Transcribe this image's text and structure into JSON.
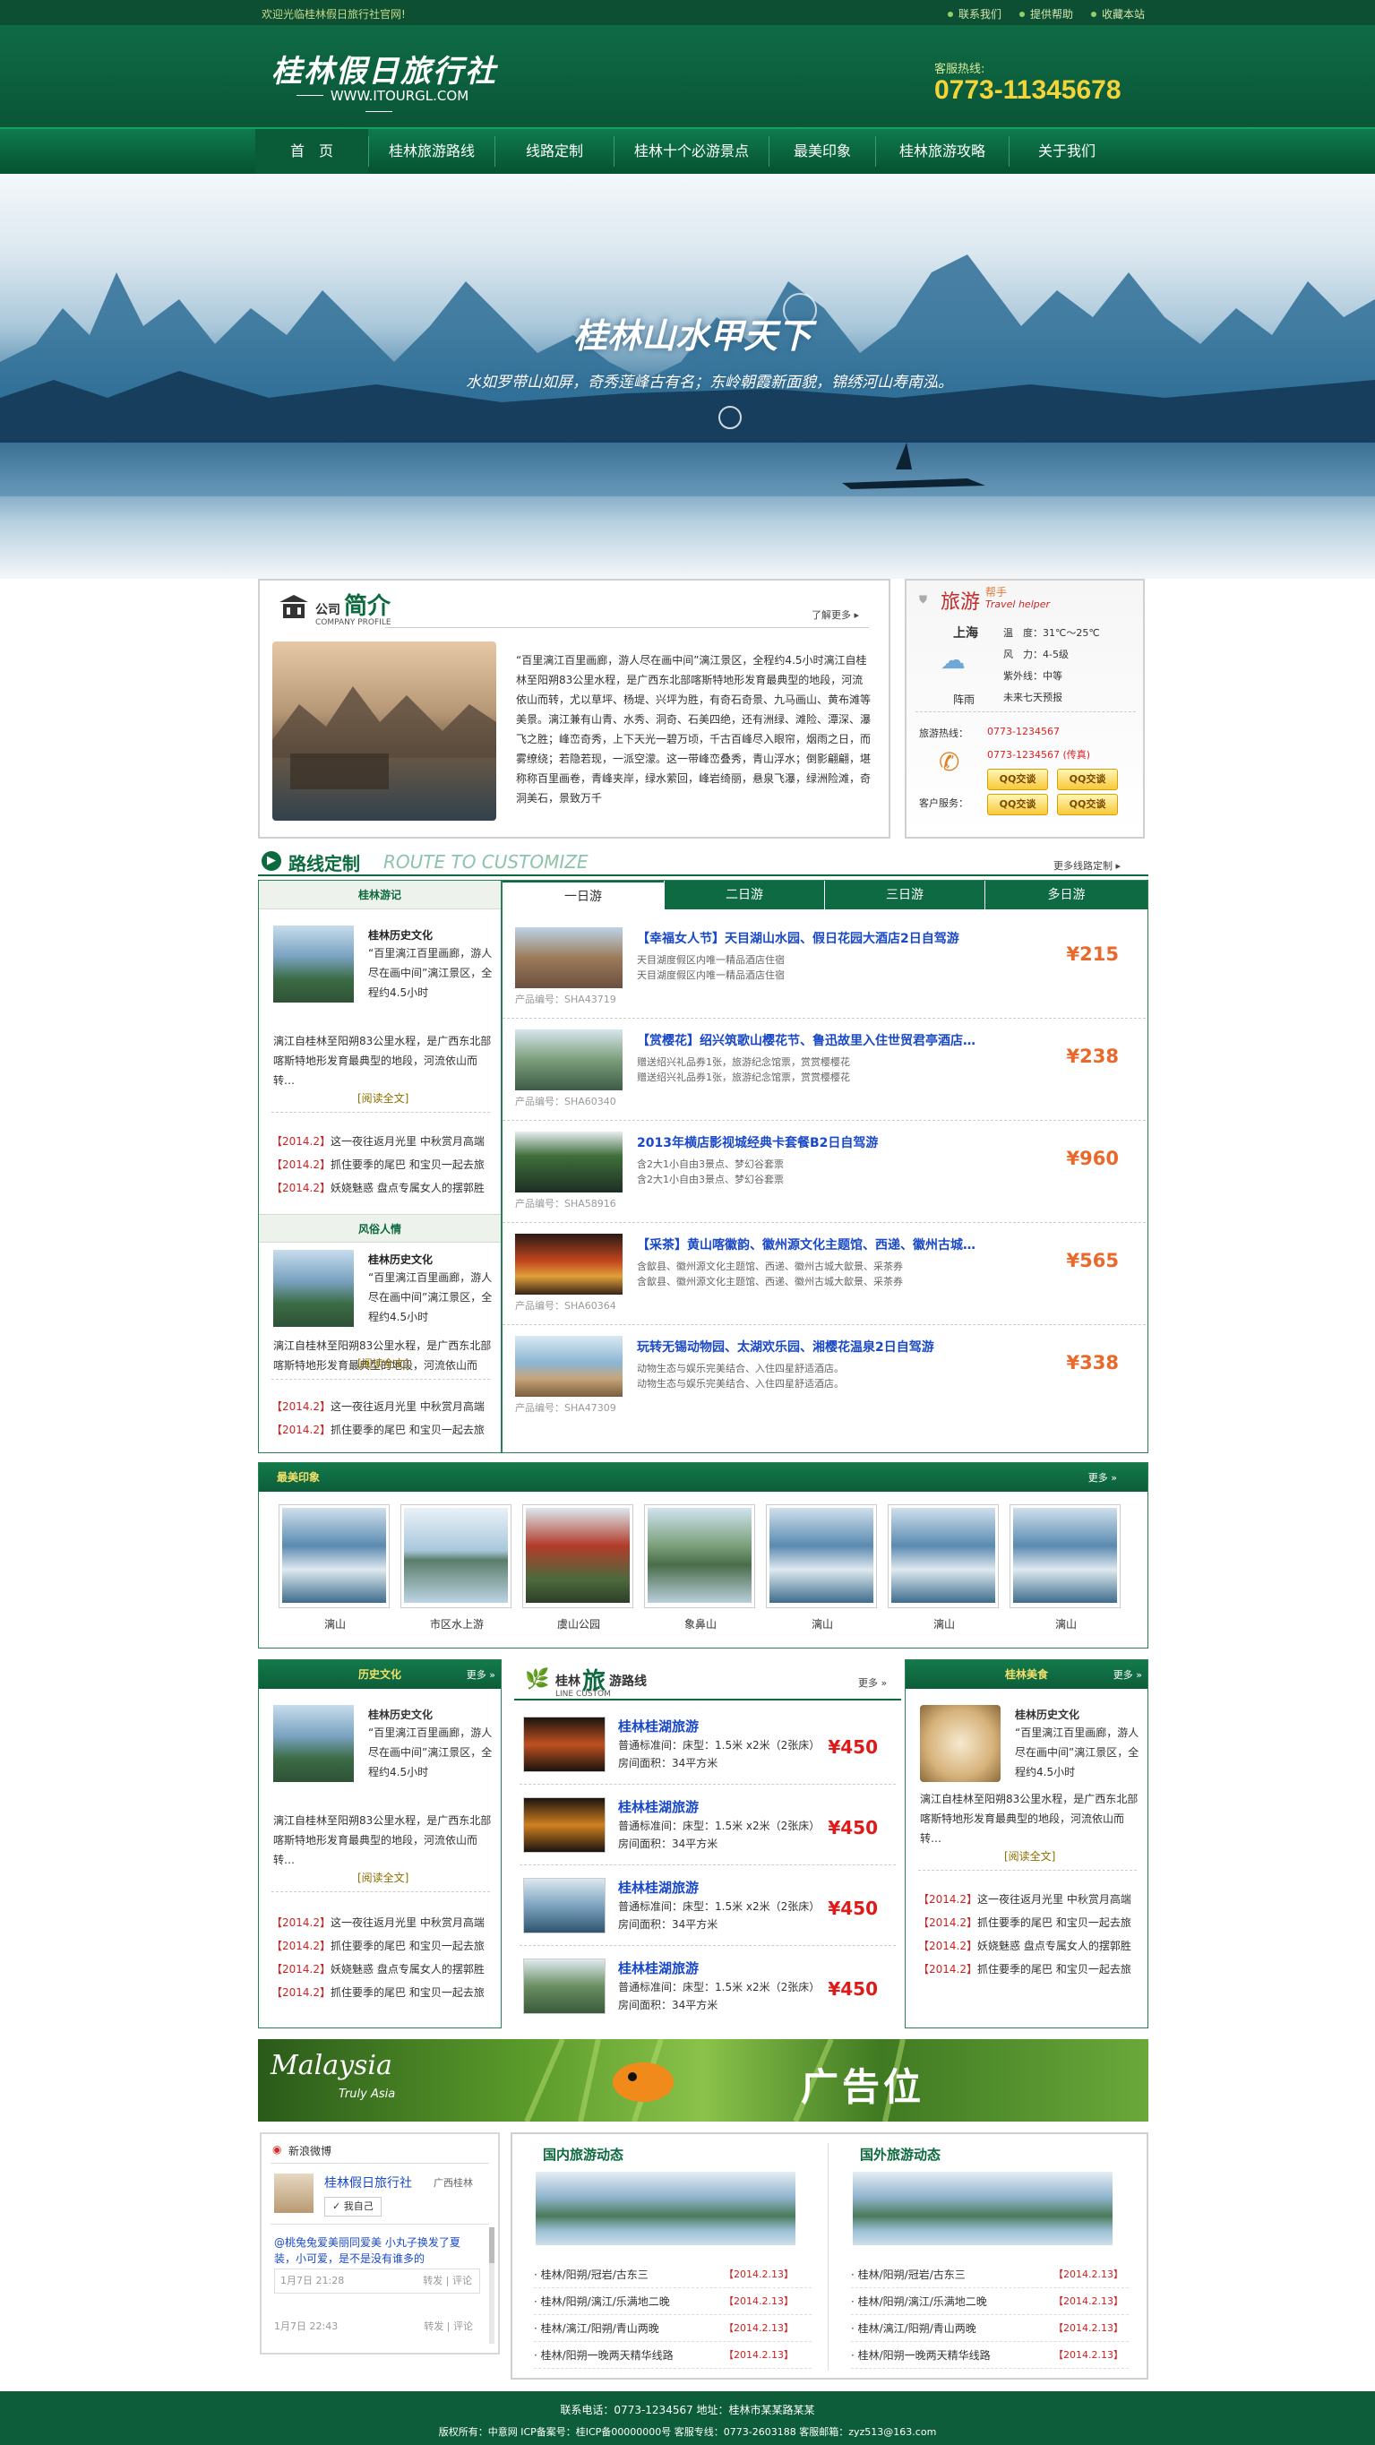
{
  "topbar": {
    "welcome": "欢迎光临桂林假日旅行社官网!",
    "links": [
      "联系我们",
      "提供帮助",
      "收藏本站"
    ]
  },
  "header": {
    "logo": "桂林假日旅行社",
    "site": "WWW.ITOURGL.COM",
    "hotline_label": "客服热线:",
    "hotline": "0773-11345678"
  },
  "nav": [
    "首　页",
    "桂林旅游路线",
    "线路定制",
    "桂林十个必游景点",
    "最美印象",
    "桂林旅游攻略",
    "关于我们"
  ],
  "banner": {
    "title": "桂林山水甲天下",
    "subtitle": "水如罗带山如屏，奇秀莲峰古有名；东岭朝霞新面貌，锦绣河山寿南泓。"
  },
  "company": {
    "title_cn": "公司",
    "title_big": "简介",
    "title_en": "COMPANY PROFILE",
    "more": "了解更多",
    "text": "“百里漓江百里画廊，游人尽在画中间”漓江景区，全程约4.5小时漓江自桂林至阳朔83公里水程，是广西东北部喀斯特地形发育最典型的地段，河流依山而转，尤以草坪、杨堤、兴坪为胜，有奇石奇景、九马画山、黄布滩等美景。漓江兼有山青、水秀、洞奇、石美四绝，还有洲绿、滩险、潭深、瀑飞之胜；峰峦奇秀，上下天光一碧万顷，千古百峰尽入眼帘，烟雨之日，而雾缭绕；若隐若现，一派空濛。这一带峰峦叠秀，青山浮水；倒影翩翩，堪称称百里画卷，青峰夹岸，绿水萦回，峰岩绮丽，悬泉飞瀑，绿洲险滩，奇洞美石，景致万千"
  },
  "helper": {
    "title": "旅游",
    "sub": "帮手",
    "en": "Travel helper",
    "city": "上海",
    "weather": "阵雨",
    "temp": "温　度：31℃～25℃",
    "wind": "风　力：4-5级",
    "uv": "紫外线：中等",
    "forecast": "未来七天预报",
    "hotline_label": "旅游热线：",
    "phone1": "0773-1234567",
    "phone2": "0773-1234567 (传真)",
    "service_label": "客户服务：",
    "qq": "QQ交谈"
  },
  "route": {
    "title": "路线定制",
    "title_en": "ROUTE TO CUSTOMIZE",
    "more": "更多线路定制",
    "tabs": [
      "一日游",
      "二日游",
      "三日游",
      "多日游"
    ],
    "items": [
      {
        "title": "【幸福女人节】天目湖山水园、假日花园大酒店2日自驾游",
        "desc": [
          "天目湖度假区内唯一精品酒店住宿",
          "天目湖度假区内唯一精品酒店住宿"
        ],
        "code": "产品编号：SHA43719",
        "price": "¥215"
      },
      {
        "title": "【赏樱花】绍兴筑歌山樱花节、鲁迅故里入住世贸君亭酒店…",
        "desc": [
          "赠送绍兴礼品券1张，旅游纪念馆票，赏赏樱樱花",
          "赠送绍兴礼品券1张，旅游纪念馆票，赏赏樱樱花"
        ],
        "code": "产品编号：SHA60340",
        "price": "¥238"
      },
      {
        "title": "2013年横店影视城经典卡套餐B2日自驾游",
        "desc": [
          "含2大1小自由3景点、梦幻谷套票",
          "含2大1小自由3景点、梦幻谷套票"
        ],
        "code": "产品编号：SHA58916",
        "price": "¥960"
      },
      {
        "title": "【采茶】黄山喀徽韵、徽州源文化主题馆、西递、徽州古城…",
        "desc": [
          "含歙县、徽州源文化主题馆、西递、徽州古城大歙景、采茶券",
          "含歙县、徽州源文化主题馆、西递、徽州古城大歙景、采茶券"
        ],
        "code": "产品编号：SHA60364",
        "price": "¥565"
      },
      {
        "title": "玩转无锡动物园、太湖欢乐园、湘樱花温泉2日自驾游",
        "desc": [
          "动物生态与娱乐完美结合、入住四星舒适酒店。",
          "动物生态与娱乐完美结合、入住四星舒适酒店。"
        ],
        "code": "产品编号：SHA47309",
        "price": "¥338"
      }
    ]
  },
  "left_col": {
    "sec1": "桂林游记",
    "sec2": "风俗人情",
    "article_title": "桂林历史文化",
    "article_text": "“百里漓江百里画廊，游人尽在画中间”漓江景区，全程约4.5小时",
    "article_text2": "“百里漓江百里画廊，游人尽在画中间”漓江景区，全程约4.5小时",
    "article_text3": "漓江自桂林至阳朔83公里水程，是广西东北部喀斯特地形发育最典型的地段，河流依山而转…",
    "read_more": "[阅读全文]",
    "news1": [
      {
        "d": "【2014.2】",
        "t": "这一夜往返月光里 中秋赏月高端"
      },
      {
        "d": "【2014.2】",
        "t": "抓住要季的尾巴 和宝贝一起去旅"
      },
      {
        "d": "【2014.2】",
        "t": "妖娆魅惑 盘点专属女人的摆郭胜"
      }
    ],
    "news2": [
      {
        "d": "【2014.2】",
        "t": "这一夜往返月光里 中秋赏月高端"
      },
      {
        "d": "【2014.2】",
        "t": "抓住要季的尾巴 和宝贝一起去旅"
      }
    ]
  },
  "impression": {
    "title": "最美印象",
    "more": "更多",
    "photos": [
      "漓山",
      "市区水上游",
      "虞山公园",
      "象鼻山",
      "漓山",
      "漓山",
      "漓山"
    ]
  },
  "bottom": {
    "hist_title": "历史文化",
    "more": "更多",
    "food_title": "桂林美食",
    "news": [
      {
        "d": "【2014.2】",
        "t": "这一夜往返月光里 中秋赏月高端"
      },
      {
        "d": "【2014.2】",
        "t": "抓住要季的尾巴 和宝贝一起去旅"
      },
      {
        "d": "【2014.2】",
        "t": "妖娆魅惑 盘点专属女人的摆郭胜"
      },
      {
        "d": "【2014.2】",
        "t": "抓住要季的尾巴 和宝贝一起去旅"
      }
    ],
    "line_title_a": "桂林",
    "line_title_b": "旅",
    "line_title_c": "游路线",
    "line_en": "LINE CUSTOM",
    "lines": [
      {
        "t": "桂林桂湖旅游",
        "d1": "普通标准间：床型：1.5米 x2米（2张床）",
        "d2": "房间面积：34平方米",
        "p": "¥450"
      },
      {
        "t": "桂林桂湖旅游",
        "d1": "普通标准间：床型：1.5米 x2米（2张床）",
        "d2": "房间面积：34平方米",
        "p": "¥450"
      },
      {
        "t": "桂林桂湖旅游",
        "d1": "普通标准间：床型：1.5米 x2米（2张床）",
        "d2": "房间面积：34平方米",
        "p": "¥450"
      },
      {
        "t": "桂林桂湖旅游",
        "d1": "普通标准间：床型：1.5米 x2米（2张床）",
        "d2": "房间面积：34平方米",
        "p": "¥450"
      }
    ]
  },
  "ad": {
    "brand": "Malaysia",
    "brand_sub": "Truly Asia",
    "text": "广告位"
  },
  "weibo": {
    "title": "新浪微博",
    "name": "桂林假日旅行社",
    "loc": "广西桂林",
    "follow": "我自己",
    "post1": "@桃兔兔爱美丽同爱美 小丸子换发了夏装，小可爱，是不是没有谁多的",
    "time1": "1月7日 21:28",
    "act1": "转发 | 评论",
    "time2": "1月7日 22:43",
    "act2": "转发 | 评论"
  },
  "news_dom": {
    "title": "国内旅游动态",
    "items": [
      {
        "t": "桂林/阳朔/冠岩/古东三",
        "d": "【2014.2.13】"
      },
      {
        "t": "桂林/阳朔/漓江/乐满地二晚",
        "d": "【2014.2.13】"
      },
      {
        "t": "桂林/漓江/阳朔/青山两晚",
        "d": "【2014.2.13】"
      },
      {
        "t": "桂林/阳朔一晚两天精华线路",
        "d": "【2014.2.13】"
      }
    ]
  },
  "news_int": {
    "title": "国外旅游动态",
    "items": [
      {
        "t": "桂林/阳朔/冠岩/古东三",
        "d": "【2014.2.13】"
      },
      {
        "t": "桂林/阳朔/漓江/乐满地二晚",
        "d": "【2014.2.13】"
      },
      {
        "t": "桂林/漓江/阳朔/青山两晚",
        "d": "【2014.2.13】"
      },
      {
        "t": "桂林/阳朔一晚两天精华线路",
        "d": "【2014.2.13】"
      }
    ]
  },
  "footer": {
    "line1": "联系电话：0773-1234567  地址：桂林市某某路某某",
    "line2": "版权所有：中意网 ICP备案号：桂ICP备00000000号  客服专线：0773-2603188  客服邮箱：zyz513@163.com"
  }
}
